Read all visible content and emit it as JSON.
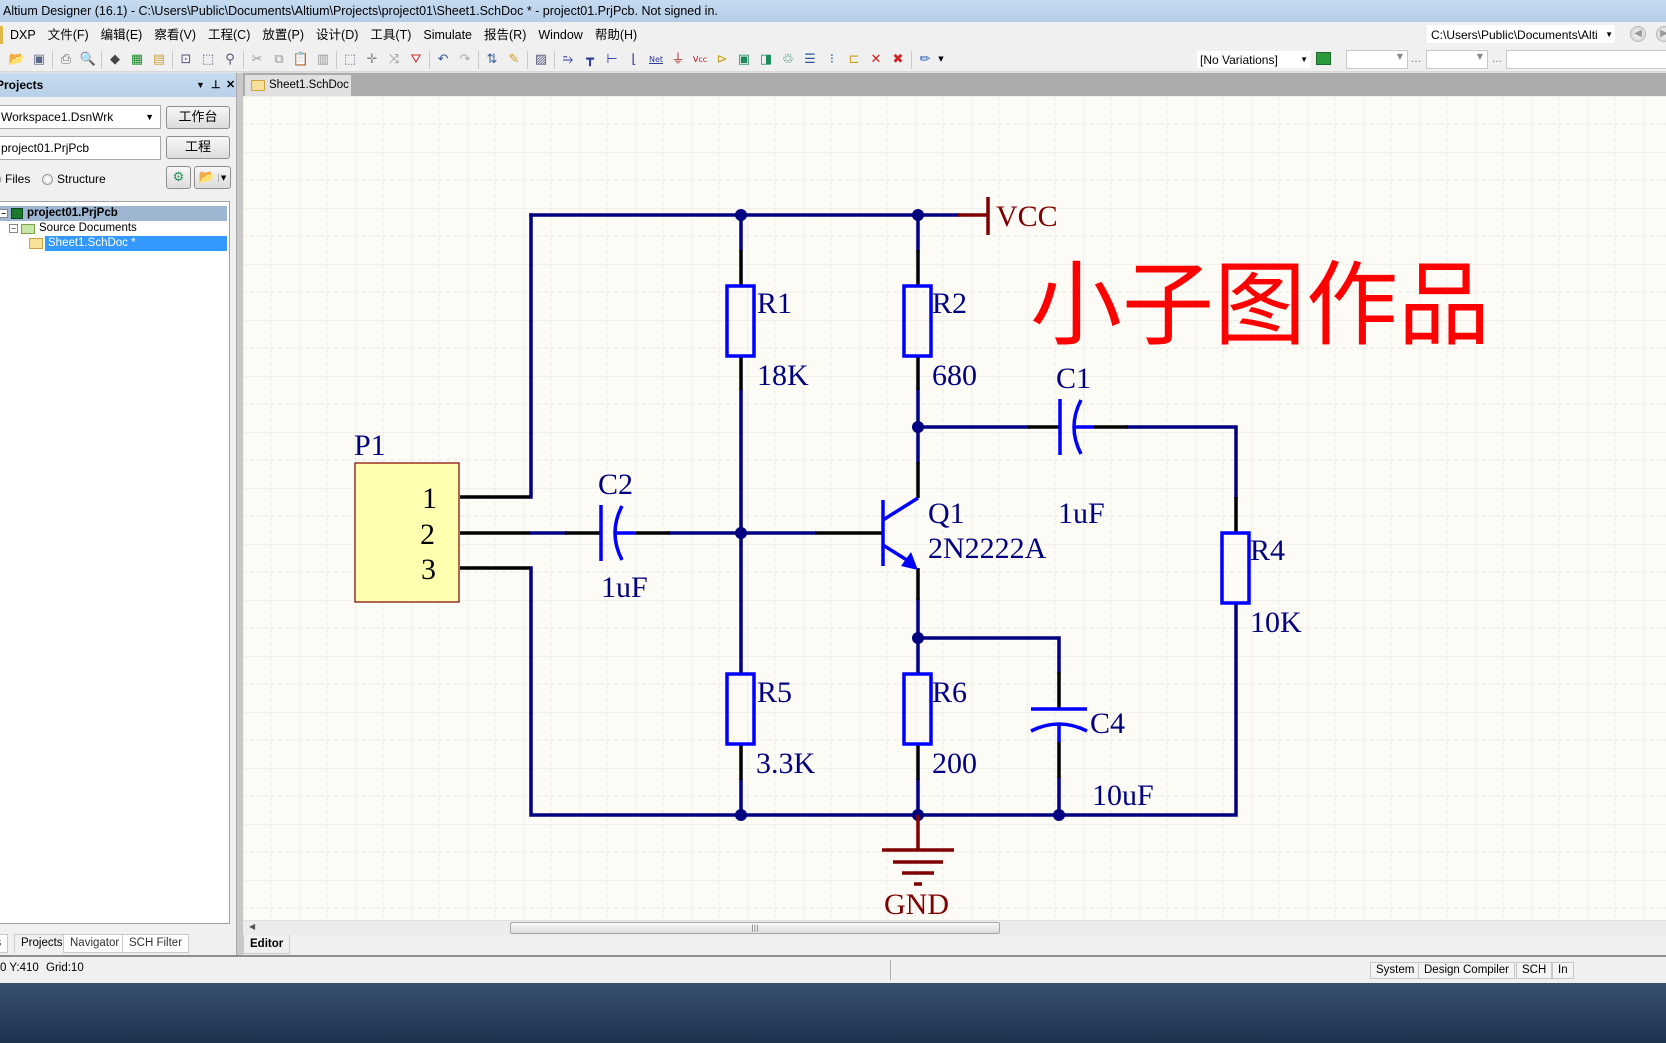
{
  "window": {
    "title": "Altium Designer (16.1) - C:\\Users\\Public\\Documents\\Altium\\Projects\\project01\\Sheet1.SchDoc * - project01.PrjPcb. Not signed in."
  },
  "menubar": {
    "items": [
      "DXP",
      "文件(F)",
      "编辑(E)",
      "察看(V)",
      "工程(C)",
      "放置(P)",
      "设计(D)",
      "工具(T)",
      "Simulate",
      "报告(R)",
      "Window",
      "帮助(H)"
    ],
    "path_combo": "C:\\Users\\Public\\Documents\\Alti"
  },
  "toolbar": {
    "variations": "[No Variations]",
    "icons": [
      "open-icon",
      "save-icon",
      "print-icon",
      "print-preview-icon",
      "3d-view-icon",
      "pcb-icon",
      "document-icon",
      "zoom-fit-icon",
      "zoom-area-icon",
      "zoom-selected-icon",
      "cut-icon",
      "copy-icon",
      "paste-icon",
      "rubber-stamp-icon",
      "select-area-icon",
      "move-icon",
      "cross-select-icon",
      "clear-filter-icon",
      "undo-icon",
      "redo-icon",
      "hierarchy-icon",
      "cross-probe-icon",
      "browse-component-icon",
      "wire-icon",
      "bus-icon",
      "bus-entry-icon",
      "net-label-icon",
      "net-label-text-icon",
      "gnd-port-icon",
      "vcc-port-icon",
      "place-part-icon",
      "sheet-symbol-icon",
      "sheet-entry-icon",
      "device-sheet-icon",
      "harness-icon",
      "harness-entry-icon",
      "port-icon",
      "directive-icon",
      "no-erc-icon",
      "compile-mask-icon",
      "pencil-icon"
    ]
  },
  "projects_panel": {
    "title": "Projects",
    "workspace": "Workspace1.DsnWrk",
    "workspace_button": "工作台",
    "project": "project01.PrjPcb",
    "project_button": "工程",
    "view_options": [
      "Files",
      "Structure"
    ],
    "selected_view": "Files",
    "tree": [
      {
        "label": "project01.PrjPcb",
        "level": 0,
        "icon": "pcb-project-icon"
      },
      {
        "label": "Source Documents",
        "level": 1,
        "icon": "folder-icon"
      },
      {
        "label": "Sheet1.SchDoc *",
        "level": 2,
        "icon": "schematic-doc-icon",
        "selected": true
      }
    ],
    "tabs": [
      "Files",
      "Projects",
      "Navigator",
      "SCH Filter"
    ],
    "active_tab": "Projects"
  },
  "document": {
    "tab": "Sheet1.SchDoc *",
    "editor_tab": "Editor"
  },
  "schematic": {
    "watermark": "小子图作品",
    "power": {
      "vcc": "VCC",
      "gnd": "GND"
    },
    "components": {
      "P1": {
        "designator": "P1",
        "pins": [
          "1",
          "2",
          "3"
        ]
      },
      "R1": {
        "designator": "R1",
        "value": "18K"
      },
      "R2": {
        "designator": "R2",
        "value": "680"
      },
      "R4": {
        "designator": "R4",
        "value": "10K"
      },
      "R5": {
        "designator": "R5",
        "value": "3.3K"
      },
      "R6": {
        "designator": "R6",
        "value": "200"
      },
      "C1": {
        "designator": "C1",
        "value": "1uF"
      },
      "C2": {
        "designator": "C2",
        "value": "1uF"
      },
      "C4": {
        "designator": "C4",
        "value": "10uF"
      },
      "Q1": {
        "designator": "Q1",
        "value": "2N2222A"
      }
    },
    "colors": {
      "wire": "#000080",
      "component": "#0000ff",
      "pin": "#000000",
      "power": "#800000",
      "label": "#000080",
      "watermark": "#ff0000",
      "connector_fill": "#ffffb0",
      "connector_border": "#800000"
    }
  },
  "statusbar": {
    "coords": "0 Y:410",
    "grid": "Grid:10",
    "buttons": [
      "System",
      "Design Compiler",
      "SCH",
      "In"
    ]
  }
}
